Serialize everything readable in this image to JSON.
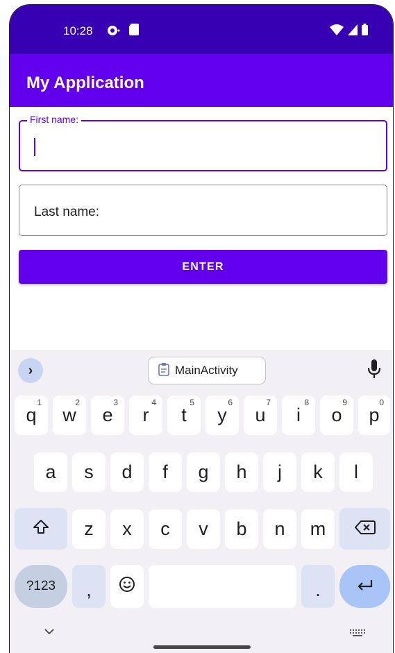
{
  "status_bar": {
    "time": "10:28",
    "icons": [
      "sync-icon",
      "sd-card-icon",
      "wifi-icon",
      "signal-icon",
      "battery-icon"
    ]
  },
  "app_bar": {
    "title": "My Application"
  },
  "form": {
    "first_name": {
      "label": "First name:",
      "value": "",
      "focused": true
    },
    "last_name": {
      "label": "Last name:",
      "value": ""
    },
    "enter_button": "ENTER"
  },
  "keyboard": {
    "suggestion_chip": "MainActivity",
    "row1": [
      {
        "k": "q",
        "hint": "1"
      },
      {
        "k": "w",
        "hint": "2"
      },
      {
        "k": "e",
        "hint": "3"
      },
      {
        "k": "r",
        "hint": "4"
      },
      {
        "k": "t",
        "hint": "5"
      },
      {
        "k": "y",
        "hint": "6"
      },
      {
        "k": "u",
        "hint": "7"
      },
      {
        "k": "i",
        "hint": "8"
      },
      {
        "k": "o",
        "hint": "9"
      },
      {
        "k": "p",
        "hint": "0"
      }
    ],
    "row2": [
      "a",
      "s",
      "d",
      "f",
      "g",
      "h",
      "j",
      "k",
      "l"
    ],
    "row3": [
      "z",
      "x",
      "c",
      "v",
      "b",
      "n",
      "m"
    ],
    "symbols_key": "?123",
    "comma_key": ",",
    "period_key": "."
  },
  "colors": {
    "status_bar": "#3700b3",
    "primary": "#6200ee",
    "keyboard_bg": "#f2f0f4"
  }
}
